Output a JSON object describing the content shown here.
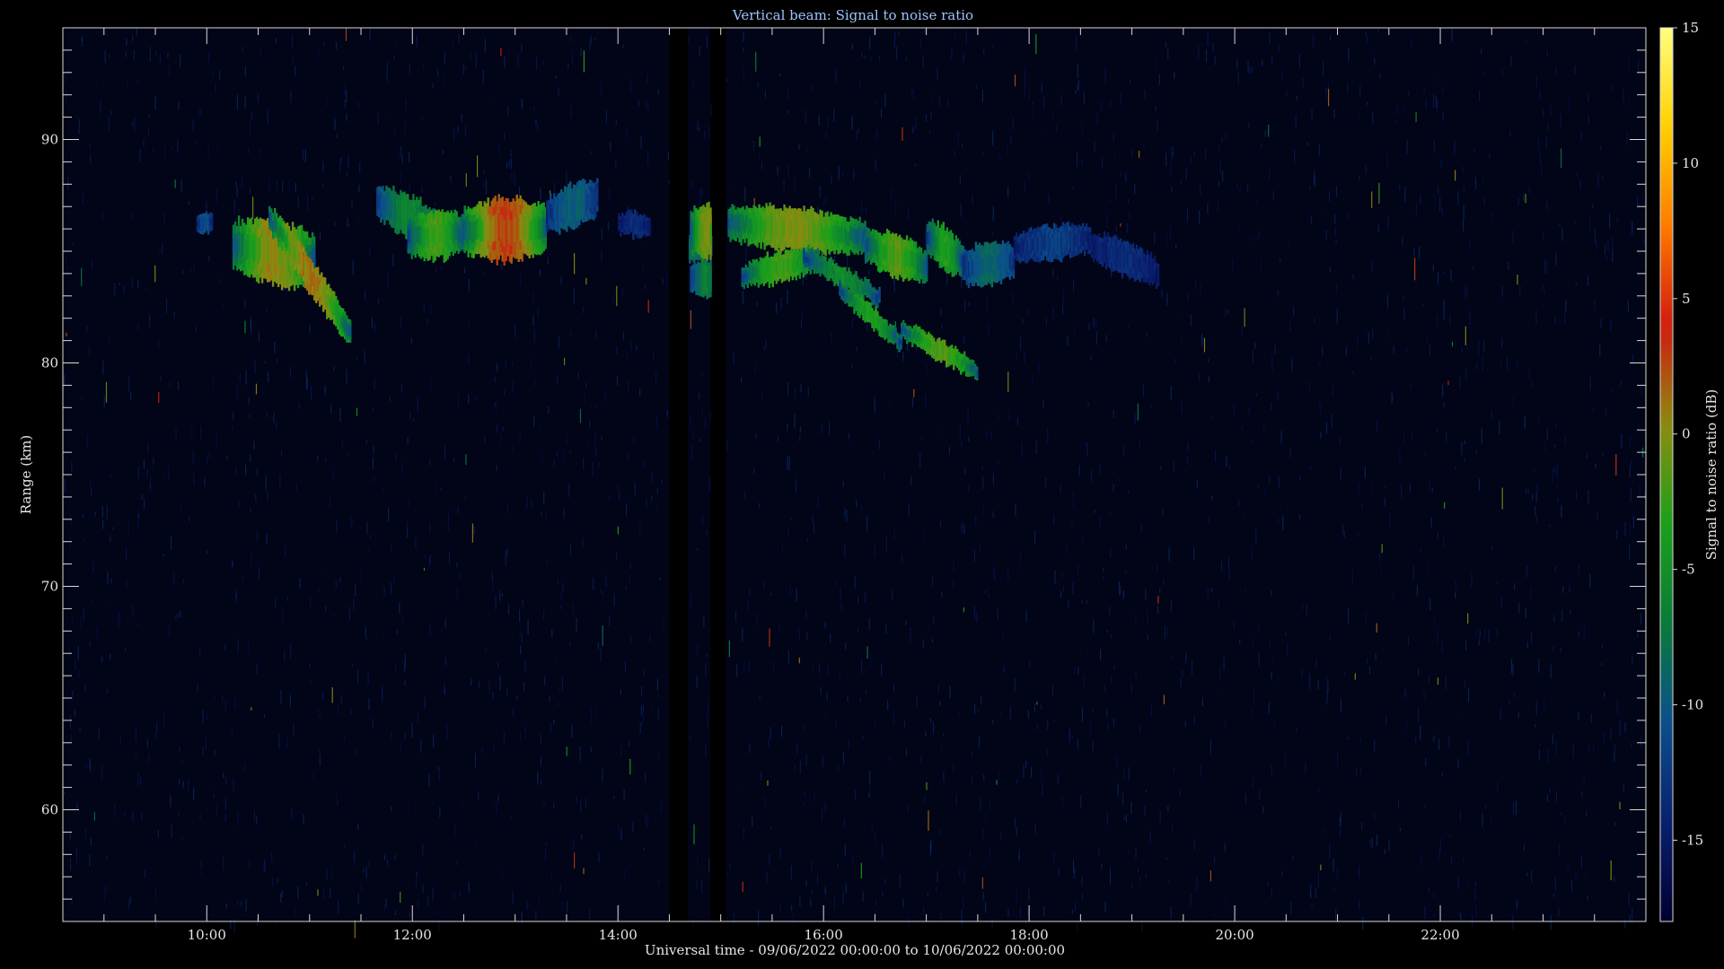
{
  "chart_data": {
    "type": "heatmap",
    "title": "Vertical beam: Signal to noise ratio",
    "xlabel": "Universal time - 09/06/2022 00:00:00 to 10/06/2022 00:00:00",
    "ylabel": "Range (km)",
    "colorbar_label": "Signal to noise ratio (dB)",
    "x_range_hours": [
      8.6,
      24.0
    ],
    "y_range_km": [
      55,
      95
    ],
    "x_ticks": [
      {
        "hour": 10,
        "label": "10:00"
      },
      {
        "hour": 12,
        "label": "12:00"
      },
      {
        "hour": 14,
        "label": "14:00"
      },
      {
        "hour": 16,
        "label": "16:00"
      },
      {
        "hour": 18,
        "label": "18:00"
      },
      {
        "hour": 20,
        "label": "20:00"
      },
      {
        "hour": 22,
        "label": "22:00"
      }
    ],
    "y_ticks": [
      {
        "km": 60,
        "label": "60"
      },
      {
        "km": 70,
        "label": "70"
      },
      {
        "km": 80,
        "label": "80"
      },
      {
        "km": 90,
        "label": "90"
      }
    ],
    "colorbar_range_db": [
      -18,
      15
    ],
    "colorbar_ticks": [
      {
        "db": 15,
        "label": "15"
      },
      {
        "db": 10,
        "label": "10"
      },
      {
        "db": 5,
        "label": "5"
      },
      {
        "db": 0,
        "label": "0"
      },
      {
        "db": -5,
        "label": "-5"
      },
      {
        "db": -10,
        "label": "-10"
      },
      {
        "db": -15,
        "label": "-15"
      }
    ],
    "colormap": [
      "#000030",
      "#0a1f6e",
      "#0b4f8c",
      "#0a7a3a",
      "#1aa01a",
      "#8c8c10",
      "#d01a10",
      "#ff7a00",
      "#ffd000",
      "#ffff80"
    ],
    "background_db": -16,
    "data_gap_hours": [
      [
        14.5,
        14.68
      ],
      [
        14.9,
        15.05
      ]
    ],
    "echo_features": [
      {
        "t_start": 9.9,
        "t_end": 10.05,
        "km_start": 86.2,
        "km_end": 86.2,
        "thickness_km": 0.8,
        "peak_db": -8
      },
      {
        "t_start": 10.25,
        "t_end": 11.05,
        "km_start": 85.3,
        "km_end": 84.6,
        "thickness_km": 2.4,
        "peak_db": 9
      },
      {
        "t_start": 10.6,
        "t_end": 11.4,
        "km_start": 86.5,
        "km_end": 81.3,
        "thickness_km": 1.3,
        "peak_db": 10
      },
      {
        "t_start": 11.65,
        "t_end": 12.3,
        "km_start": 87.2,
        "km_end": 85.8,
        "thickness_km": 1.6,
        "peak_db": -1
      },
      {
        "t_start": 11.95,
        "t_end": 12.5,
        "km_start": 85.6,
        "km_end": 85.8,
        "thickness_km": 1.8,
        "peak_db": 5
      },
      {
        "t_start": 12.5,
        "t_end": 13.3,
        "km_start": 85.9,
        "km_end": 86.0,
        "thickness_km": 2.3,
        "peak_db": 13
      },
      {
        "t_start": 13.3,
        "t_end": 13.8,
        "km_start": 86.6,
        "km_end": 87.4,
        "thickness_km": 1.6,
        "peak_db": -6
      },
      {
        "t_start": 14.0,
        "t_end": 14.3,
        "km_start": 86.2,
        "km_end": 86.2,
        "thickness_km": 0.9,
        "peak_db": -12
      },
      {
        "t_start": 14.55,
        "t_end": 14.9,
        "km_start": 84.8,
        "km_end": 85.3,
        "thickness_km": 1.0,
        "peak_db": -4
      },
      {
        "t_start": 14.7,
        "t_end": 15.0,
        "km_start": 85.9,
        "km_end": 85.9,
        "thickness_km": 2.0,
        "peak_db": 8
      },
      {
        "t_start": 14.7,
        "t_end": 15.0,
        "km_start": 83.8,
        "km_end": 83.8,
        "thickness_km": 1.4,
        "peak_db": -2
      },
      {
        "t_start": 15.05,
        "t_end": 16.4,
        "km_start": 86.3,
        "km_end": 85.6,
        "thickness_km": 1.6,
        "peak_db": 8
      },
      {
        "t_start": 15.2,
        "t_end": 15.95,
        "km_start": 83.9,
        "km_end": 84.7,
        "thickness_km": 1.1,
        "peak_db": 5
      },
      {
        "t_start": 15.8,
        "t_end": 16.55,
        "km_start": 84.8,
        "km_end": 82.9,
        "thickness_km": 0.8,
        "peak_db": 0
      },
      {
        "t_start": 16.4,
        "t_end": 17.0,
        "km_start": 85.3,
        "km_end": 84.3,
        "thickness_km": 1.6,
        "peak_db": 6
      },
      {
        "t_start": 16.15,
        "t_end": 16.75,
        "km_start": 83.3,
        "km_end": 80.9,
        "thickness_km": 0.8,
        "peak_db": 3
      },
      {
        "t_start": 16.75,
        "t_end": 17.5,
        "km_start": 81.5,
        "km_end": 79.6,
        "thickness_km": 0.8,
        "peak_db": 6
      },
      {
        "t_start": 17.0,
        "t_end": 17.35,
        "km_start": 85.7,
        "km_end": 84.5,
        "thickness_km": 1.6,
        "peak_db": 3
      },
      {
        "t_start": 17.35,
        "t_end": 17.85,
        "km_start": 84.3,
        "km_end": 84.6,
        "thickness_km": 1.6,
        "peak_db": -5
      },
      {
        "t_start": 17.85,
        "t_end": 18.6,
        "km_start": 85.2,
        "km_end": 85.6,
        "thickness_km": 1.3,
        "peak_db": -10
      },
      {
        "t_start": 18.6,
        "t_end": 19.25,
        "km_start": 85.3,
        "km_end": 84.0,
        "thickness_km": 1.3,
        "peak_db": -12
      }
    ],
    "grid": false,
    "colorbar_position": "right"
  }
}
